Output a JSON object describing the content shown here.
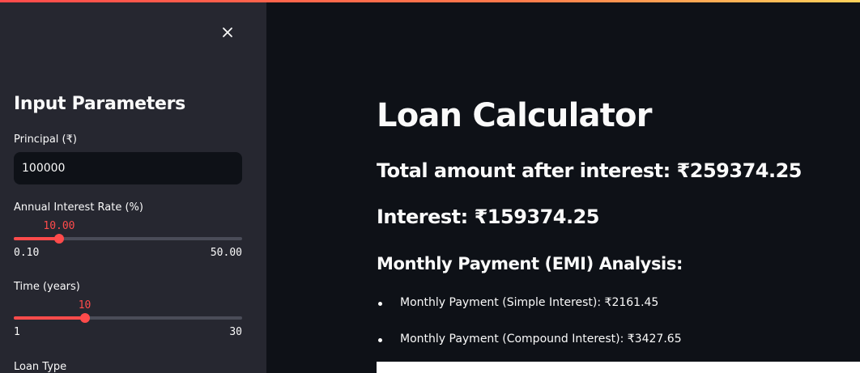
{
  "sidebar": {
    "title": "Input Parameters",
    "principal": {
      "label": "Principal (₹)",
      "value": "100000"
    },
    "interest_rate": {
      "label": "Annual Interest Rate (%)",
      "value": 10.0,
      "value_text": "10.00",
      "min_text": "0.10",
      "max_text": "50.00",
      "min": 0.1,
      "max": 50.0
    },
    "time": {
      "label": "Time (years)",
      "value": 10,
      "value_text": "10",
      "min_text": "1",
      "max_text": "30",
      "min": 1,
      "max": 30
    },
    "loan_type": {
      "label": "Loan Type"
    }
  },
  "main": {
    "title": "Loan Calculator",
    "total_amount": "Total amount after interest: ₹259374.25",
    "interest": "Interest: ₹159374.25",
    "emi_heading": "Monthly Payment (EMI) Analysis:",
    "emi_items": [
      "Monthly Payment (Simple Interest): ₹2161.45",
      "Monthly Payment (Compound Interest): ₹3427.65"
    ]
  },
  "colors": {
    "accent": "#ff4b4b",
    "sidebar_bg": "#262730",
    "main_bg": "#0e1117"
  },
  "icons": {
    "close": "close-icon"
  }
}
